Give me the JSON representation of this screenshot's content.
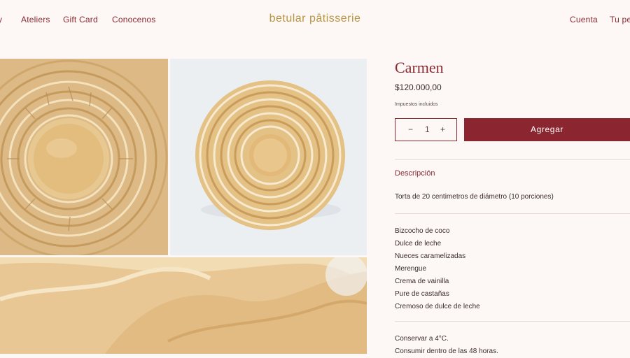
{
  "colors": {
    "accent": "#8a2b32",
    "logo": "#b8963f",
    "background": "#fdf7f6"
  },
  "nav": {
    "left": [
      "y",
      "Ateliers",
      "Gift Card",
      "Conocenos"
    ],
    "logo": "betular pâtisserie",
    "account": "Cuenta",
    "cart": "Tu pe"
  },
  "product": {
    "title": "Carmen",
    "price": "$120.000,00",
    "tax_note": "Impuestos incluidos",
    "quantity": {
      "minus": "−",
      "value": "1",
      "plus": "+"
    },
    "add_button": "Agregar",
    "description_heading": "Descripción",
    "description": "Torta de 20 centimetros de diámetro (10 porciones)",
    "ingredients": [
      "Bizcocho de coco",
      "Dulce de leche",
      "Nueces caramelizadas",
      "Merengue",
      "Crema de vainilla",
      "Pure de castañas",
      "Cremoso de dulce de leche"
    ],
    "notes": [
      "Conservar a 4°C.",
      "Consumir dentro de las 48 horas."
    ]
  },
  "gallery_icons": [
    "cake-closeup-image",
    "cake-top-view-image",
    "cake-texture-image"
  ]
}
